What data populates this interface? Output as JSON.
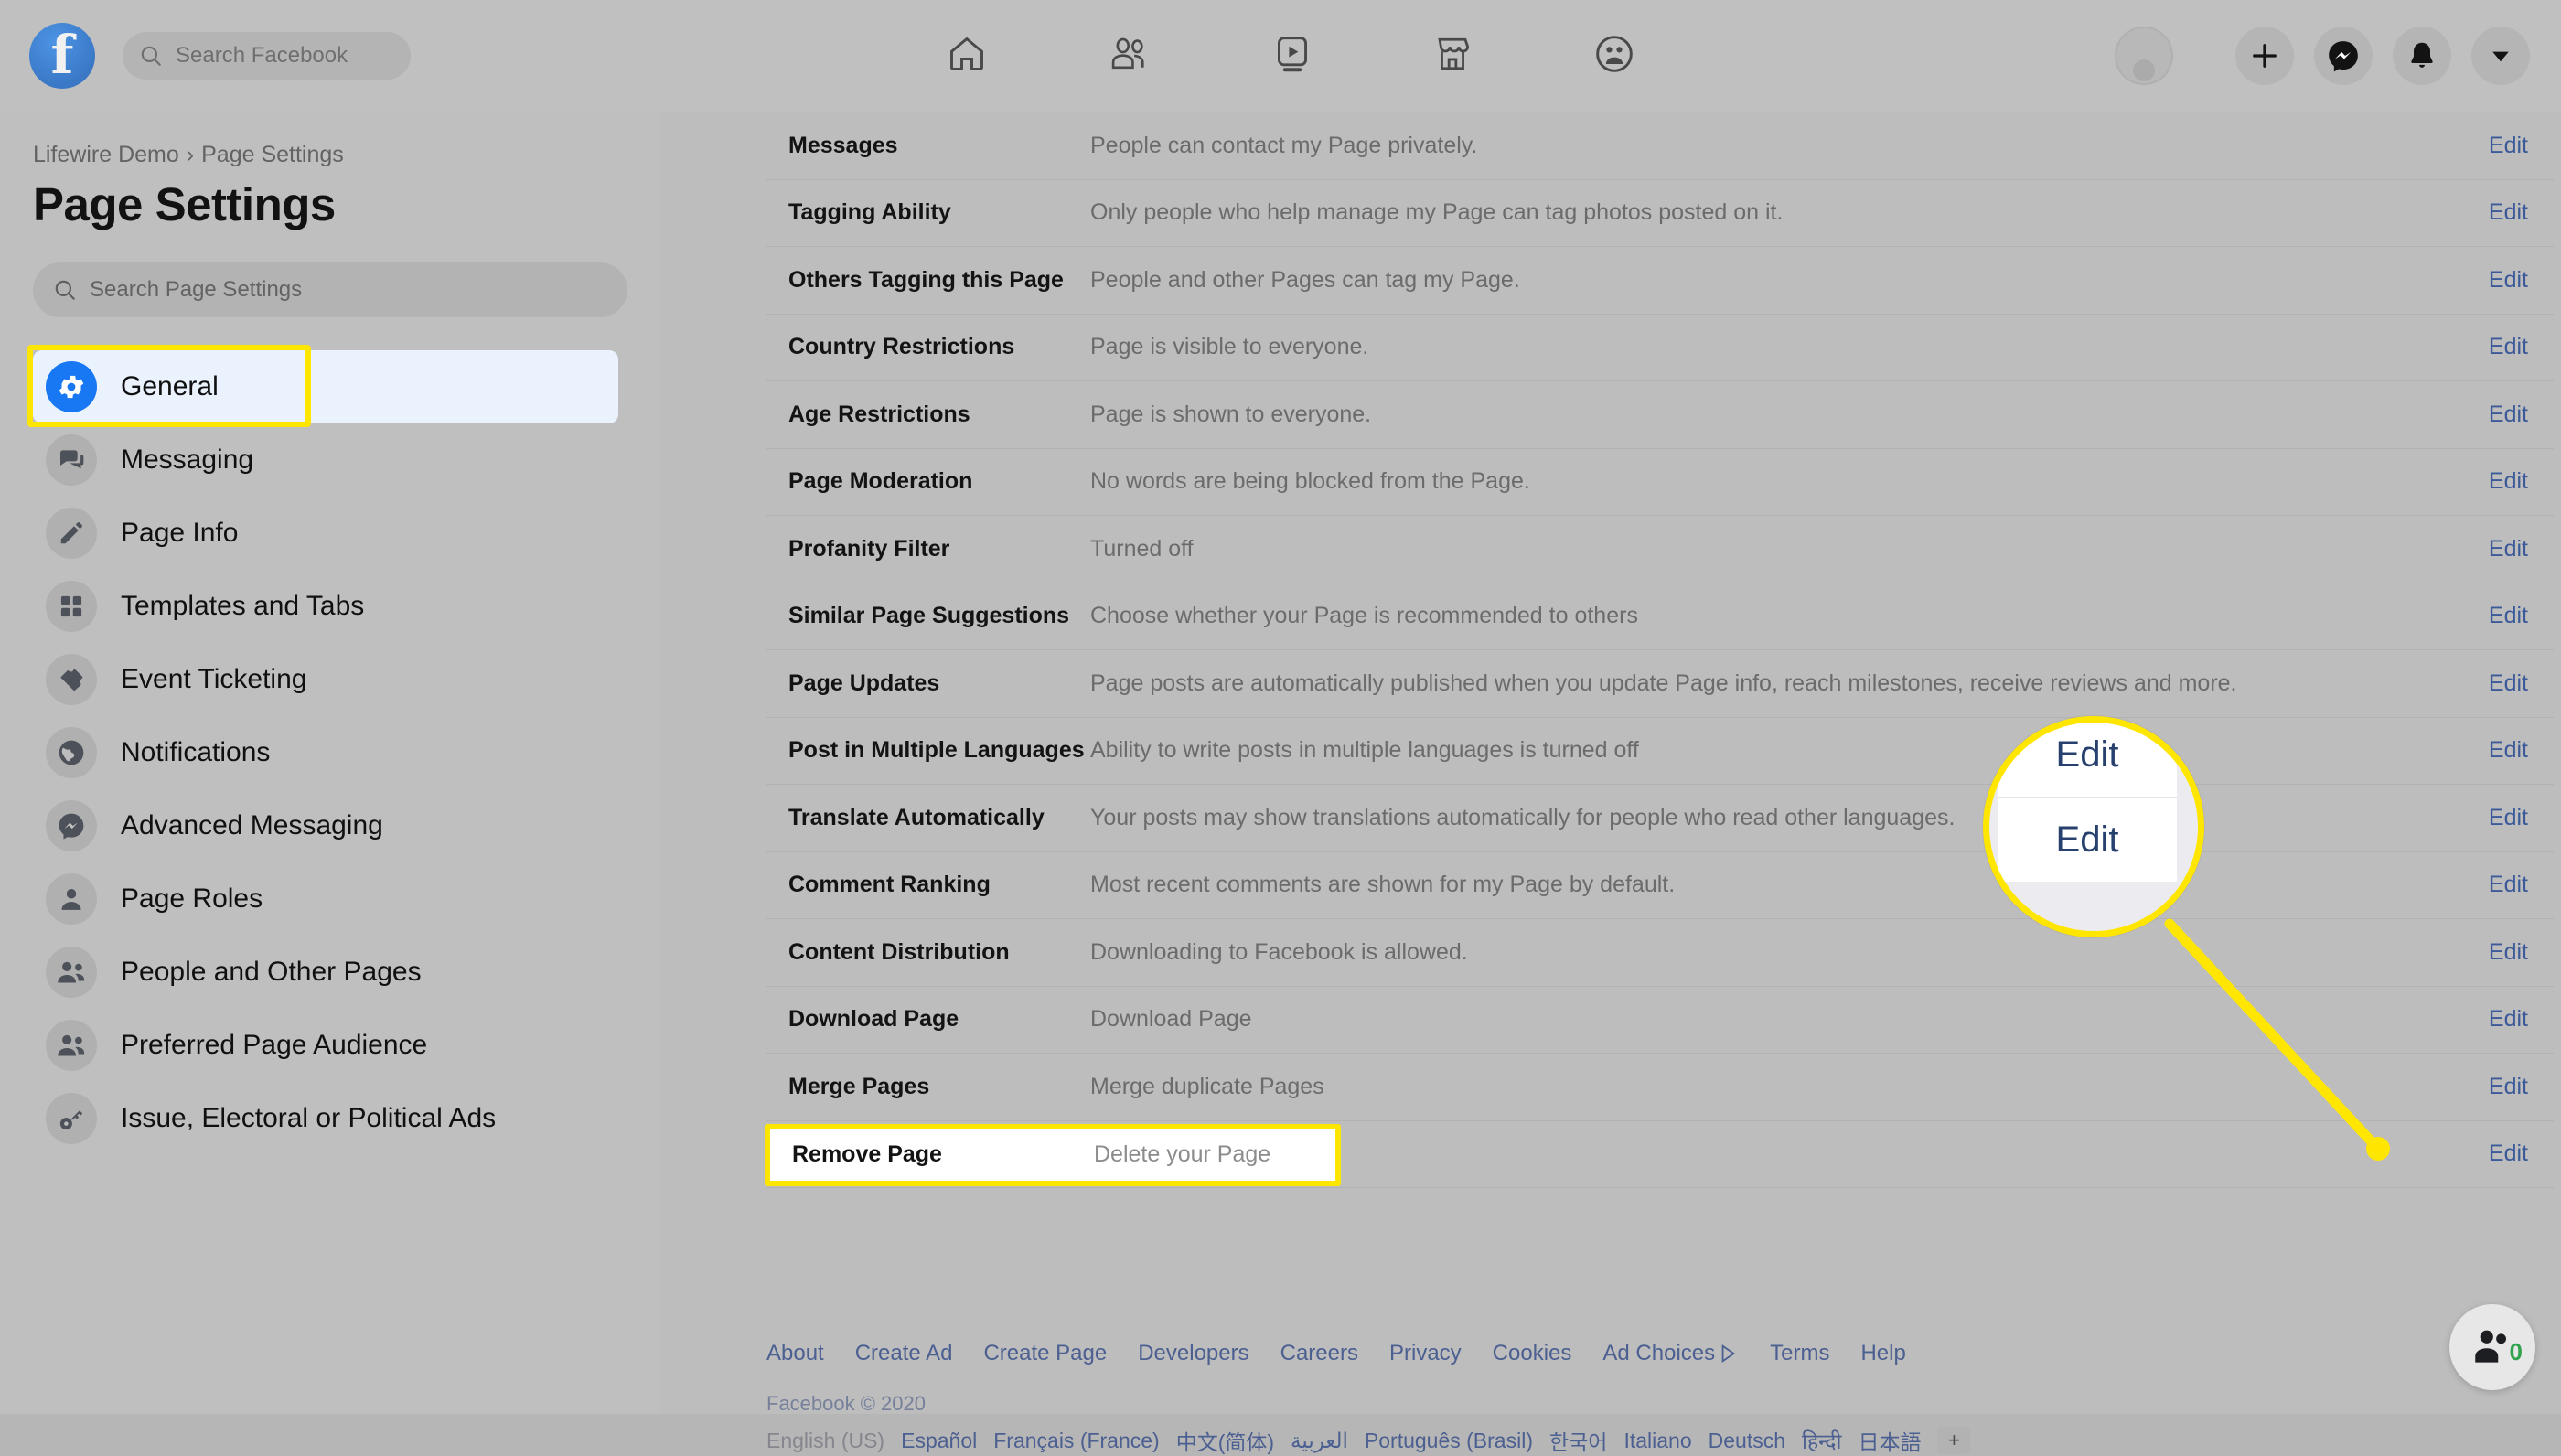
{
  "topnav": {
    "logo": "facebook-logo",
    "search_placeholder": "Search Facebook",
    "center_icons": [
      "home-icon",
      "friends-icon",
      "watch-icon",
      "marketplace-icon",
      "groups-icon"
    ],
    "right_icons": [
      "profile-avatar",
      "plus-icon",
      "messenger-icon",
      "bell-icon",
      "chevron-down-icon"
    ]
  },
  "sidebar": {
    "breadcrumb_page": "Lifewire Demo",
    "breadcrumb_sep": "›",
    "breadcrumb_current": "Page Settings",
    "title": "Page Settings",
    "search_placeholder": "Search Page Settings",
    "items": [
      {
        "label": "General",
        "icon": "gear-icon",
        "active": true
      },
      {
        "label": "Messaging",
        "icon": "chat-bubbles-icon",
        "active": false
      },
      {
        "label": "Page Info",
        "icon": "pencil-icon",
        "active": false
      },
      {
        "label": "Templates and Tabs",
        "icon": "grid-squares-icon",
        "active": false
      },
      {
        "label": "Event Ticketing",
        "icon": "ticket-icon",
        "active": false
      },
      {
        "label": "Notifications",
        "icon": "globe-icon",
        "active": false
      },
      {
        "label": "Advanced Messaging",
        "icon": "messenger-icon",
        "active": false
      },
      {
        "label": "Page Roles",
        "icon": "person-icon",
        "active": false
      },
      {
        "label": "People and Other Pages",
        "icon": "people-icon",
        "active": false
      },
      {
        "label": "Preferred Page Audience",
        "icon": "people-icon",
        "active": false
      },
      {
        "label": "Issue, Electoral or Political Ads",
        "icon": "key-icon",
        "active": false
      }
    ]
  },
  "settings": {
    "edit_label": "Edit",
    "rows": [
      {
        "name": "Messages",
        "desc": "People can contact my Page privately.",
        "edit": "Edit"
      },
      {
        "name": "Tagging Ability",
        "desc": "Only people who help manage my Page can tag photos posted on it.",
        "edit": "Edit"
      },
      {
        "name": "Others Tagging this Page",
        "desc": "People and other Pages can tag my Page.",
        "edit": "Edit"
      },
      {
        "name": "Country Restrictions",
        "desc": "Page is visible to everyone.",
        "edit": "Edit"
      },
      {
        "name": "Age Restrictions",
        "desc": "Page is shown to everyone.",
        "edit": "Edit"
      },
      {
        "name": "Page Moderation",
        "desc": "No words are being blocked from the Page.",
        "edit": "Edit"
      },
      {
        "name": "Profanity Filter",
        "desc": "Turned off",
        "edit": "Edit"
      },
      {
        "name": "Similar Page Suggestions",
        "desc": "Choose whether your Page is recommended to others",
        "edit": "Edit"
      },
      {
        "name": "Page Updates",
        "desc": "Page posts are automatically published when you update Page info, reach milestones, receive reviews and more.",
        "edit": "Edit"
      },
      {
        "name": "Post in Multiple Languages",
        "desc": "Ability to write posts in multiple languages is turned off",
        "edit": "Edit"
      },
      {
        "name": "Translate Automatically",
        "desc": "Your posts may show translations automatically for people who read other languages.",
        "edit": "Edit"
      },
      {
        "name": "Comment Ranking",
        "desc": "Most recent comments are shown for my Page by default.",
        "edit": "Edit"
      },
      {
        "name": "Content Distribution",
        "desc": "Downloading to Facebook is allowed.",
        "edit": "Edit"
      },
      {
        "name": "Download Page",
        "desc": "Download Page",
        "edit": "Edit"
      },
      {
        "name": "Merge Pages",
        "desc": "Merge duplicate Pages",
        "edit": "Edit"
      },
      {
        "name": "Remove Page",
        "desc": "Delete your Page",
        "edit": "Edit",
        "highlighted": true
      }
    ]
  },
  "magnifier": {
    "edit_top": "Edit",
    "edit_bottom": "Edit"
  },
  "footer": {
    "links": [
      "About",
      "Create Ad",
      "Create Page",
      "Developers",
      "Careers",
      "Privacy",
      "Cookies",
      "Ad Choices",
      "Terms",
      "Help"
    ],
    "adchoices_icon": "adchoices-icon",
    "copyright": "Facebook © 2020",
    "languages": [
      "English (US)",
      "Español",
      "Français (France)",
      "中文(简体)",
      "العربية",
      "Português (Brasil)",
      "한국어",
      "Italiano",
      "Deutsch",
      "हिन्दी",
      "日本語"
    ],
    "language_more": "+"
  },
  "contacts": {
    "icon": "contacts-icon",
    "count": "0"
  },
  "colors": {
    "highlight_yellow": "#ffe600",
    "facebook_blue": "#1877f2",
    "link_blue": "#3c5a99",
    "active_item_bg": "#eaf2fd"
  }
}
